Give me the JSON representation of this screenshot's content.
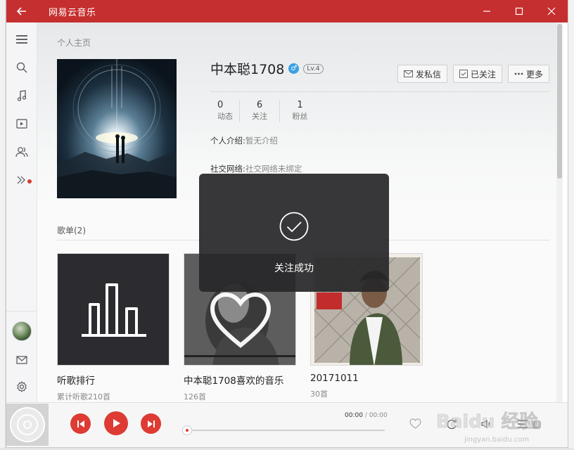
{
  "app": {
    "title": "网易云音乐",
    "accent": "#c62f2f"
  },
  "rail": {
    "icons": [
      "menu-icon",
      "search-icon",
      "music-note-icon",
      "video-icon",
      "friends-icon",
      "more-arrow-icon",
      "avatar",
      "mail-icon",
      "settings-icon"
    ]
  },
  "profile": {
    "breadcrumb": "个人主页",
    "username": "中本聪1708",
    "gender_symbol": "♂",
    "level": "Lv.4",
    "buttons": {
      "message": "发私信",
      "followed": "已关注",
      "more": "更多"
    },
    "stats": [
      {
        "value": "0",
        "label": "动态"
      },
      {
        "value": "6",
        "label": "关注"
      },
      {
        "value": "1",
        "label": "粉丝"
      }
    ],
    "intro_label": "个人介绍:",
    "intro_value": "暂无介绍",
    "social_label": "社交网络:",
    "social_value": "社交网络未绑定"
  },
  "playlists": {
    "section_title": "歌单(2)",
    "items": [
      {
        "name": "听歌排行",
        "sub": "累计听歌210首"
      },
      {
        "name": "中本聪1708喜欢的音乐",
        "sub": "126首"
      },
      {
        "name": "20171011",
        "sub": "30首"
      }
    ]
  },
  "toast": {
    "message": "关注成功"
  },
  "player": {
    "time_current": "00:00",
    "time_separator": "/",
    "time_total": "00:00",
    "queue_count": "0",
    "progress": 0
  },
  "watermark": {
    "text": "Baidu 经验",
    "url": "jingyan.baidu.com"
  }
}
